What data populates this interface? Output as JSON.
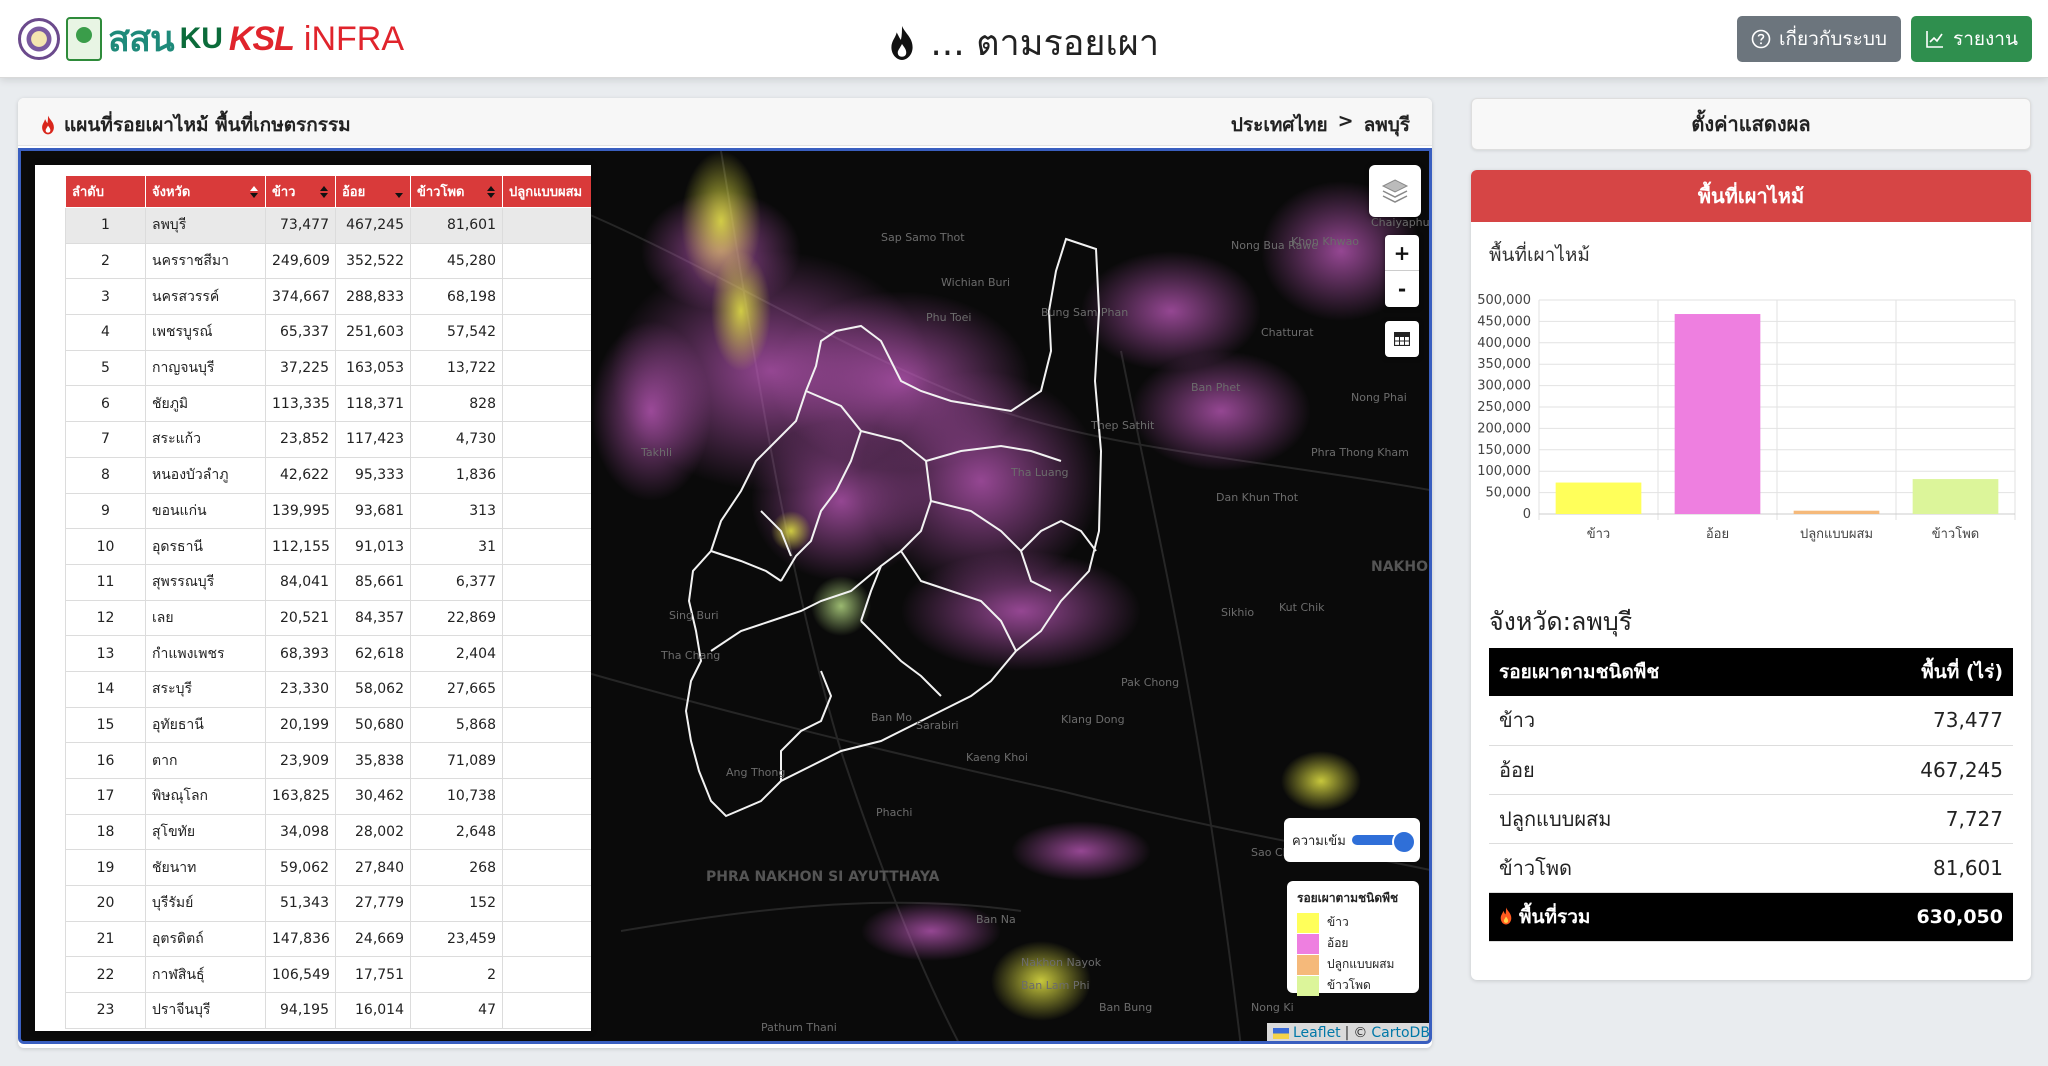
{
  "header": {
    "logo_text_sson": "สสน",
    "logo_text_ku": "KU",
    "logo_text_ksl": "KSL",
    "logo_text_infra": "iNFRA",
    "title": "... ตามรอยเผา",
    "about_label": "เกี่ยวกับระบบ",
    "report_label": "รายงาน"
  },
  "map_panel": {
    "title": "แผนที่รอยเผาไหม้ พื้นที่เกษตรกรรม",
    "breadcrumb": [
      "ประเทศไทย",
      ">",
      "ลพบุรี"
    ],
    "intensity_label": "ความเข้ม",
    "legend_title": "รอยเผาตามชนิดพืช",
    "legend": [
      {
        "label": "ข้าว",
        "color": "#ffff5a"
      },
      {
        "label": "อ้อย",
        "color": "#ee7fe0"
      },
      {
        "label": "ปลูกแบบผสม",
        "color": "#f5b97a"
      },
      {
        "label": "ข้าวโพด",
        "color": "#dcf59a"
      }
    ],
    "attribution": {
      "leaflet": "Leaflet",
      "sep": "|",
      "copy": "©",
      "cartodb": "CartoDB"
    },
    "place_labels": [
      "Chaiyaphum",
      "Nong Bua Rawe",
      "Khon Khwao",
      "Sap Samo Thot",
      "Wichian Buri",
      "Phu Toei",
      "Bung Sam Phan",
      "Chatturat",
      "Ban Phet",
      "Nong Phai",
      "Thep Sathit",
      "Tha Luang",
      "Phra Thong Kham",
      "Dan Khun Thot",
      "Sikhio",
      "Kut Chik",
      "NAKHON RATCHASIMA",
      "Pak Chong",
      "Klang Dong",
      "Sarabiri",
      "Kaeng Khoi",
      "Ban Mo",
      "Phachi",
      "Ang Thong",
      "PHRA NAKHON SI AYUTTHAYA",
      "Ban Na",
      "Nakhon Nayok",
      "Ban Lam Phi",
      "Ban Bung",
      "Pathum Thani",
      "Sing Buri",
      "Tha Chang",
      "Takhli",
      "Sao Chao Pho",
      "Nong Ki"
    ]
  },
  "rank_table": {
    "headers": [
      "ลำดับ",
      "จังหวัด",
      "ข้าว",
      "อ้อย",
      "ข้าวโพด",
      "ปลูกแบบผสม"
    ],
    "rows": [
      [
        "1",
        "ลพบุรี",
        "73,477",
        "467,245",
        "81,601"
      ],
      [
        "2",
        "นครราชสีมา",
        "249,609",
        "352,522",
        "45,280"
      ],
      [
        "3",
        "นครสวรรค์",
        "374,667",
        "288,833",
        "68,198"
      ],
      [
        "4",
        "เพชรบูรณ์",
        "65,337",
        "251,603",
        "57,542"
      ],
      [
        "5",
        "กาญจนบุรี",
        "37,225",
        "163,053",
        "13,722"
      ],
      [
        "6",
        "ชัยภูมิ",
        "113,335",
        "118,371",
        "828"
      ],
      [
        "7",
        "สระแก้ว",
        "23,852",
        "117,423",
        "4,730"
      ],
      [
        "8",
        "หนองบัวลำภู",
        "42,622",
        "95,333",
        "1,836"
      ],
      [
        "9",
        "ขอนแก่น",
        "139,995",
        "93,681",
        "313"
      ],
      [
        "10",
        "อุดรธานี",
        "112,155",
        "91,013",
        "31"
      ],
      [
        "11",
        "สุพรรณบุรี",
        "84,041",
        "85,661",
        "6,377"
      ],
      [
        "12",
        "เลย",
        "20,521",
        "84,357",
        "22,869"
      ],
      [
        "13",
        "กำแพงเพชร",
        "68,393",
        "62,618",
        "2,404"
      ],
      [
        "14",
        "สระบุรี",
        "23,330",
        "58,062",
        "27,665"
      ],
      [
        "15",
        "อุทัยธานี",
        "20,199",
        "50,680",
        "5,868"
      ],
      [
        "16",
        "ตาก",
        "23,909",
        "35,838",
        "71,089"
      ],
      [
        "17",
        "พิษณุโลก",
        "163,825",
        "30,462",
        "10,738"
      ],
      [
        "18",
        "สุโขทัย",
        "34,098",
        "28,002",
        "2,648"
      ],
      [
        "19",
        "ชัยนาท",
        "59,062",
        "27,840",
        "268"
      ],
      [
        "20",
        "บุรีรัมย์",
        "51,343",
        "27,779",
        "152"
      ],
      [
        "21",
        "อุตรดิตถ์",
        "147,836",
        "24,669",
        "23,459"
      ],
      [
        "22",
        "กาฬสินธุ์",
        "106,549",
        "17,751",
        "2"
      ],
      [
        "23",
        "ปราจีนบุรี",
        "94,195",
        "16,014",
        "47"
      ]
    ]
  },
  "settings": {
    "label": "ตั้งค่าแสดงผล"
  },
  "burn_panel": {
    "header": "พื้นที่เผาไหม้",
    "chart_title": "พื้นที่เผาไหม้",
    "province_title": "จังหวัด:ลพบุรี",
    "table_headers": [
      "รอยเผาตามชนิดพืช",
      "พื้นที่ (ไร่)"
    ],
    "rows": [
      {
        "label": "ข้าว",
        "value": "73,477"
      },
      {
        "label": "อ้อย",
        "value": "467,245"
      },
      {
        "label": "ปลูกแบบผสม",
        "value": "7,727"
      },
      {
        "label": "ข้าวโพด",
        "value": "81,601"
      }
    ],
    "total": {
      "label": "พื้นที่รวม",
      "value": "630,050"
    }
  },
  "chart_data": {
    "type": "bar",
    "title": "พื้นที่เผาไหม้",
    "categories": [
      "ข้าว",
      "อ้อย",
      "ปลูกแบบผสม",
      "ข้าวโพด"
    ],
    "values": [
      73477,
      467245,
      7727,
      81601
    ],
    "colors": [
      "#ffff5a",
      "#ee7fe0",
      "#f5b97a",
      "#dcf59a"
    ],
    "ylim": [
      0,
      500000
    ],
    "yticks": [
      "0",
      "50,000",
      "100,000",
      "150,000",
      "200,000",
      "250,000",
      "300,000",
      "350,000",
      "400,000",
      "450,000",
      "500,000"
    ],
    "grid": true
  }
}
